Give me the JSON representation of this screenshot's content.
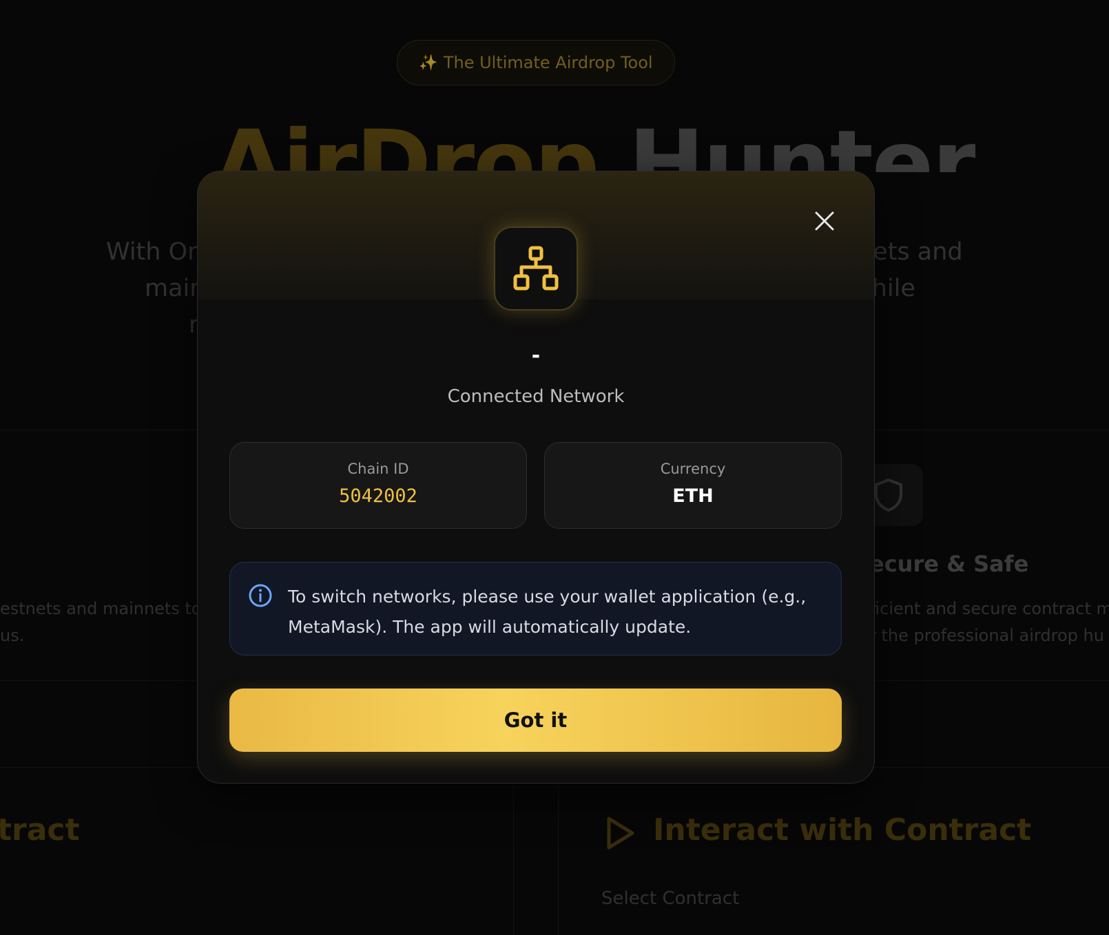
{
  "background": {
    "badge": {
      "sparkle": "✨",
      "label": "The Ultimate Airdrop Tool"
    },
    "hero": {
      "title_part1": "AirDrop",
      "title_part2": "Hunter",
      "desc_left": [
        "With Or",
        "mair",
        "r"
      ],
      "desc_right": [
        "nets and",
        "vhile",
        "."
      ]
    },
    "features": {
      "left_text": [
        "estnets and mainnets to",
        "us."
      ],
      "right_title": "ecure & Safe",
      "right_text": [
        "ficient and secure contract m",
        "r the professional airdrop hu"
      ]
    },
    "panels": {
      "left_title": "tract",
      "right_title": "Interact with Contract",
      "right_subtitle": "Select Contract"
    }
  },
  "modal": {
    "network_name": "-",
    "network_subtitle": "Connected Network",
    "chain": {
      "label": "Chain ID",
      "value": "5042002"
    },
    "currency": {
      "label": "Currency",
      "value": "ETH"
    },
    "info": "To switch networks, please use your wallet application (e.g., MetaMask). The app will automatically update.",
    "confirm_label": "Got it"
  },
  "colors": {
    "accent": "#f0c040",
    "info_blue": "#6aa8ff",
    "modal_bg": "#0e0e0e"
  },
  "icons": {
    "network": "network-icon",
    "close": "close-icon",
    "info": "info-icon",
    "shield": "shield-icon",
    "play": "play-icon"
  }
}
